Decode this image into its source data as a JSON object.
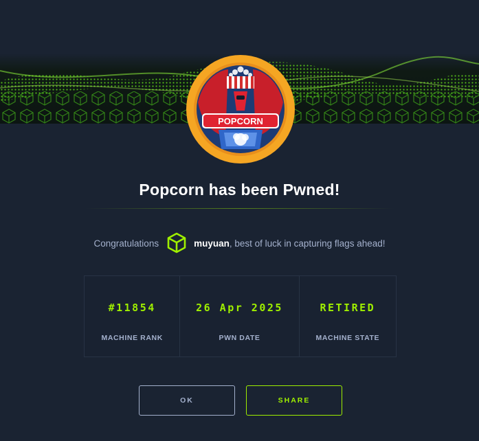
{
  "modal": {
    "title": "Popcorn has been Pwned!",
    "badge_text": "POPCORN",
    "congrats_prefix": "Congratulations",
    "username": "muyuan",
    "congrats_suffix": ", best of luck in capturing flags ahead!"
  },
  "stats": [
    {
      "value": "#11854",
      "label": "MACHINE RANK"
    },
    {
      "value": "26 Apr 2025",
      "label": "PWN DATE"
    },
    {
      "value": "RETIRED",
      "label": "MACHINE STATE"
    }
  ],
  "buttons": {
    "ok_label": "OK",
    "share_label": "SHARE"
  },
  "icons": {
    "badge": "popcorn-machine-badge-icon",
    "user": "hackthebox-cube-icon"
  },
  "colors": {
    "background": "#1a2332",
    "accent": "#9fef00",
    "text_muted": "#a4b1cd",
    "badge_ring": "#f5a623"
  }
}
